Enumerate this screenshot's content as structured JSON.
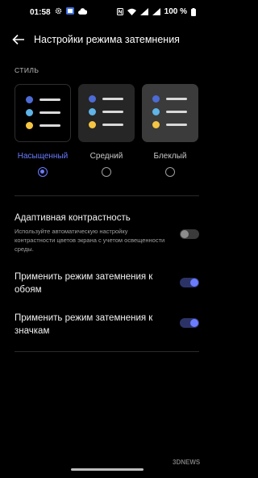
{
  "status": {
    "time": "01:58",
    "battery": "100 %"
  },
  "header": {
    "title": "Настройки режима затемнения"
  },
  "style_section": {
    "label": "СТИЛЬ",
    "options": [
      {
        "label": "Насыщенный",
        "selected": true
      },
      {
        "label": "Средний",
        "selected": false
      },
      {
        "label": "Блеклый",
        "selected": false
      }
    ]
  },
  "settings": {
    "adaptive": {
      "title": "Адаптивная контрастность",
      "desc": "Используйте автоматическую настройку контрастности цветов экрана с учетом освещенности среды.",
      "enabled": false
    },
    "wallpaper": {
      "title": "Применить режим затемнения к обоям",
      "enabled": true
    },
    "icons": {
      "title": "Применить режим затемнения к значкам",
      "enabled": true
    }
  },
  "colors": {
    "accent": "#6b7cff",
    "dot_blue": "#4c6bd4",
    "dot_cyan": "#5fb4e8",
    "dot_yellow": "#f5c542"
  },
  "watermark": "3DNEWS"
}
